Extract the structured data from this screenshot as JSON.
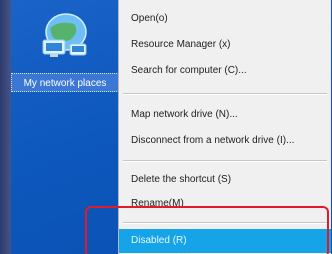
{
  "desktop": {
    "icon": {
      "name": "network-places-icon",
      "label": "My network places"
    }
  },
  "context_menu": {
    "items": [
      {
        "label": "Open(o)"
      },
      {
        "label": "Resource Manager (x)"
      },
      {
        "label": "Search for computer (C)..."
      },
      {
        "label": "Map network drive (N)..."
      },
      {
        "label": "Disconnect from a network drive (I)..."
      },
      {
        "label": "Delete the shortcut (S)"
      },
      {
        "label": "Rename(M)"
      },
      {
        "label": "Disabled (R)"
      }
    ]
  },
  "colors": {
    "desktop_blue": "#0d58bd",
    "menu_bg": "#f0f0f0",
    "highlight": "#14a4e7",
    "annotation_red": "#e21b2b"
  }
}
